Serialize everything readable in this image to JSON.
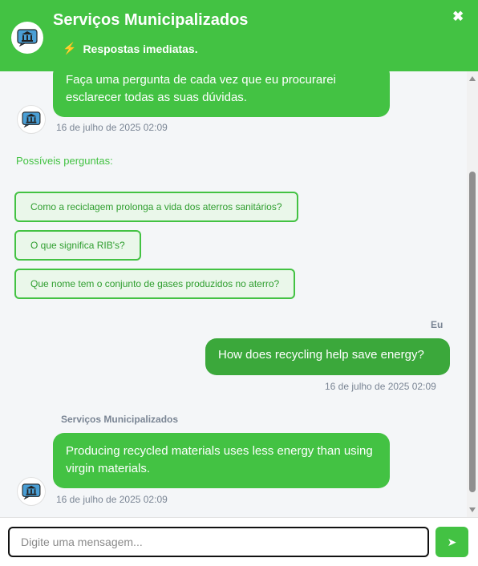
{
  "header": {
    "title": "Serviços Municipalizados",
    "subtitle": "Respostas imediatas.",
    "close_label": "✖",
    "accent_color": "#43c243"
  },
  "messages": {
    "intro_text": "Faça uma pergunta de cada vez que eu procurarei esclarecer todas as suas dúvidas.",
    "intro_time": "16 de julho de 2025 02:09",
    "possible_label": "Possíveis perguntas:",
    "suggestions": [
      "Como a reciclagem prolonga a vida dos aterros sanitários?",
      "O que significa RIB's?",
      "Que nome tem o conjunto de gases produzidos no aterro?"
    ],
    "user_label": "Eu",
    "user_text": "How does recycling help save energy?",
    "user_time": "16 de julho de 2025 02:09",
    "bot_name": "Serviços Municipalizados",
    "bot_text": "Producing recycled materials uses less energy than using virgin materials.",
    "bot_time": "16 de julho de 2025 02:09"
  },
  "composer": {
    "placeholder": "Digite uma mensagem...",
    "send_label": "➤"
  }
}
